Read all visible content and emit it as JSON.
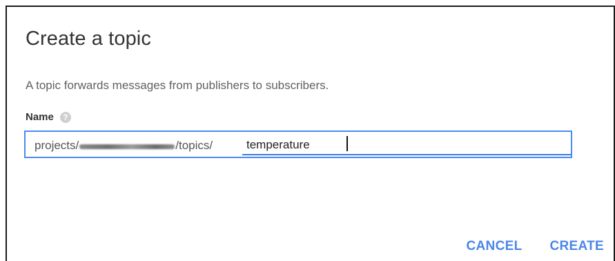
{
  "dialog": {
    "title": "Create a topic",
    "description": "A topic forwards messages from publishers to subscribers.",
    "name_label": "Name",
    "help_icon": "help-icon",
    "input": {
      "prefix_start": "projects/",
      "prefix_end": "/topics/",
      "value": "temperature"
    },
    "buttons": {
      "cancel": "CANCEL",
      "create": "CREATE"
    },
    "colors": {
      "accent": "#4a85e8",
      "border_focus": "#4a8af4"
    }
  }
}
